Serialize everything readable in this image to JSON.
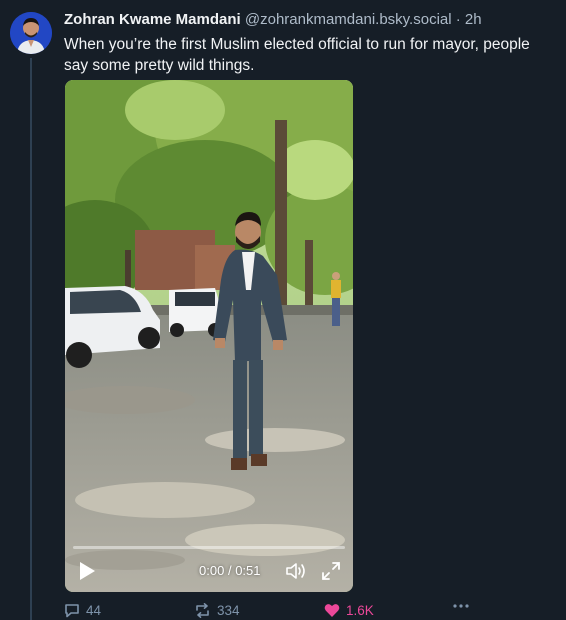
{
  "post": {
    "author": {
      "display_name": "Zohran Kwame Mamdani",
      "handle": "@zohrankmamdani.bsky.social",
      "avatar_icon": "person-avatar"
    },
    "separator": "·",
    "timestamp": "2h",
    "text": "When you’re the first Muslim elected official to run for mayor, people say some pretty wild things.",
    "video": {
      "current_time": "0:00",
      "duration": "0:51",
      "time_separator": "/",
      "progress": 0.0,
      "controls": [
        "play-icon",
        "volume-icon",
        "fullscreen-icon"
      ]
    },
    "actions": {
      "replies": "44",
      "reposts": "334",
      "likes": "1.6K",
      "liked": true
    }
  },
  "colors": {
    "background": "#161e27",
    "text": "#f1f3f5",
    "muted": "#aebbc9",
    "action": "#7e93aa",
    "like": "#ec4899",
    "thread_line": "#2e4052"
  }
}
